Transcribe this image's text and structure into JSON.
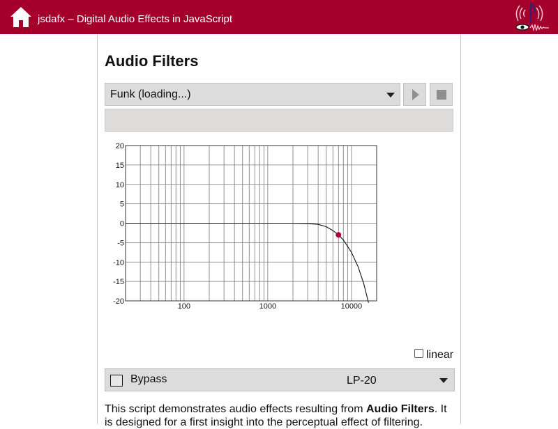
{
  "header": {
    "title": "jsdafx – Digital Audio Effects in JavaScript",
    "home_icon": "home-icon",
    "logo": "jsdafx-logo",
    "bg_color": "#a4002b"
  },
  "page": {
    "title": "Audio Filters"
  },
  "player": {
    "selected_sound": "Funk (loading...)",
    "play_icon": "play-icon",
    "stop_icon": "stop-icon",
    "progress": 0.0
  },
  "chart_data": {
    "type": "line",
    "title": "",
    "xlabel": "",
    "ylabel": "",
    "x_scale": "log",
    "xlim": [
      20,
      20000
    ],
    "ylim": [
      -20,
      20
    ],
    "x_ticks": [
      100,
      1000,
      10000
    ],
    "x_tick_labels": [
      "100",
      "1000",
      "10000"
    ],
    "y_ticks": [
      20,
      15,
      10,
      5,
      0,
      -5,
      -10,
      -15,
      -20
    ],
    "y_tick_labels": [
      "20",
      "15",
      "10",
      "5",
      "0",
      "-5",
      "-10",
      "-15",
      "-20"
    ],
    "grid": true,
    "series": [
      {
        "x": [
          20,
          100,
          1000,
          2000,
          3000,
          4000,
          5000,
          6000,
          7000,
          8000,
          10000,
          12000,
          14000,
          16000
        ],
        "y": [
          0,
          0,
          0,
          0,
          -0.1,
          -0.3,
          -0.9,
          -1.9,
          -3.0,
          -4.3,
          -7.5,
          -11.2,
          -15.5,
          -20.5
        ],
        "color": "#111111"
      }
    ],
    "marker": {
      "x": 7000,
      "y": -3.0,
      "color": "#b0003a"
    }
  },
  "controls": {
    "linear_label": "linear",
    "linear_checked": false
  },
  "filter": {
    "bypass_label": "Bypass",
    "bypass_checked": false,
    "selected_filter": "LP-20"
  },
  "description": {
    "prefix": "This script demonstrates audio effects resulting from ",
    "strong": "Audio Filters",
    "suffix": ". It is designed for a first insight into the perceptual effect of filtering."
  }
}
